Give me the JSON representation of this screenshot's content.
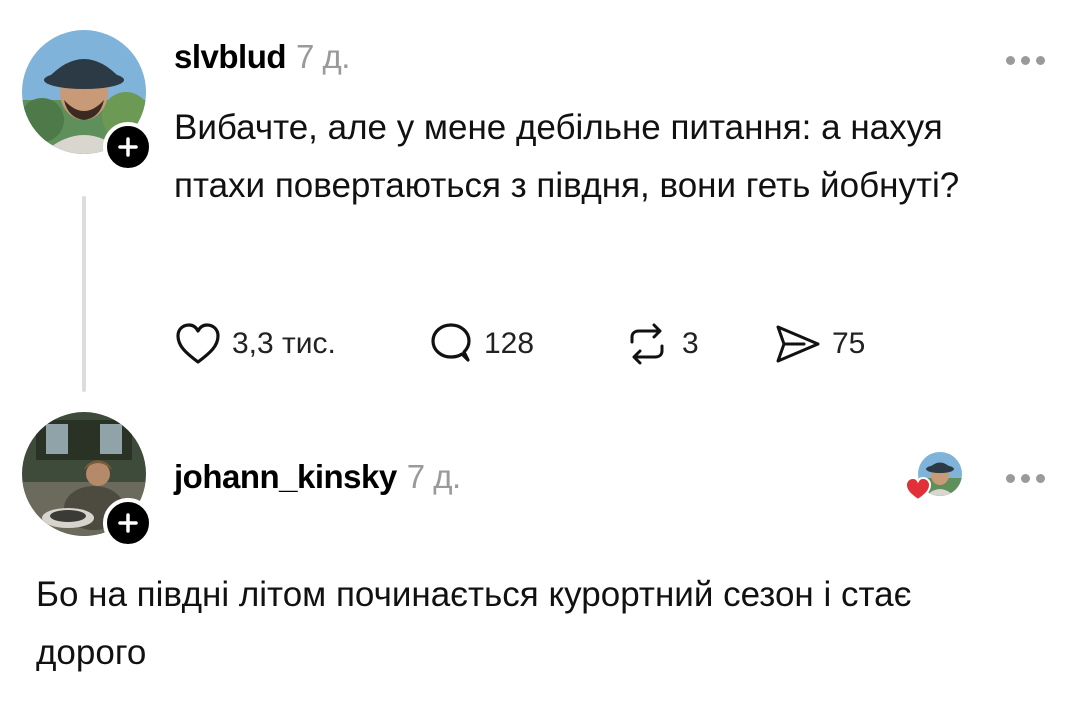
{
  "post": {
    "username": "slvblud",
    "time": "7 д.",
    "text": "Вибачте, але у мене дебільне питання: а нахуя птахи повертаються з півдня, вони геть йобнуті?",
    "likes": "3,3 тис.",
    "replies": "128",
    "reposts": "3",
    "shares": "75"
  },
  "reply": {
    "username": "johann_kinsky",
    "time": "7 д.",
    "text": "Бо на півдні літом починається курортний сезон і стає дорого",
    "liked_by_author": true
  },
  "colors": {
    "accent_heart": "#e0303a",
    "muted": "#9a9a9a",
    "thread_line": "#dcdcdc"
  },
  "icons": [
    "heart-icon",
    "reply-icon",
    "repost-icon",
    "share-icon",
    "more-icon",
    "plus-icon"
  ]
}
